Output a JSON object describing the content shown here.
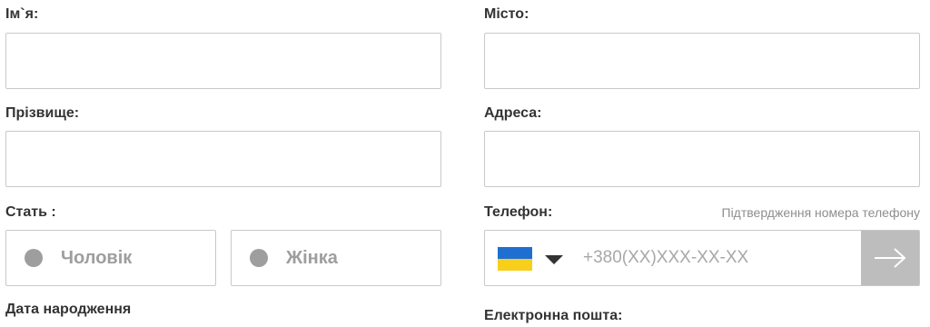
{
  "form": {
    "first_name_label": "Ім`я:",
    "last_name_label": "Прізвище:",
    "gender_label": "Стать :",
    "gender_options": [
      "Чоловік",
      "Жінка"
    ],
    "birthdate_label": "Дата народження",
    "city_label": "Місто:",
    "address_label": "Адреса:",
    "phone_label": "Телефон:",
    "phone_confirm_note": "Підтвердження номера телефону",
    "phone_placeholder": "+380(XX)XXX-XX-XX",
    "phone_country_icon": "ukraine-flag-icon",
    "phone_submit_icon": "arrow-right-icon",
    "email_label": "Електронна пошта:"
  },
  "colors": {
    "label": "#333333",
    "border": "#c9c9c9",
    "muted": "#9e9e9e",
    "submit_bg": "#bdbdbd",
    "flag_blue": "#1f6fd1",
    "flag_yellow": "#f8cf1a"
  }
}
